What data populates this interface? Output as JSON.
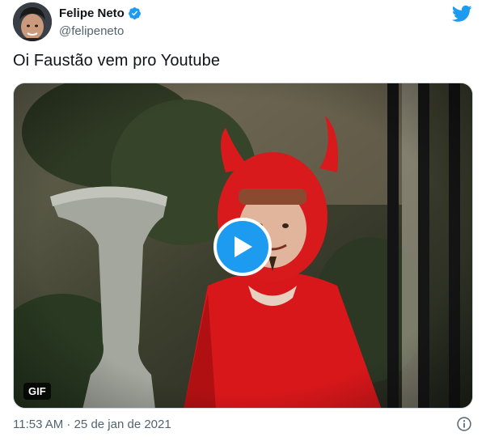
{
  "author": {
    "name": "Felipe Neto",
    "handle": "@felipeneto",
    "verified": true
  },
  "tweet": {
    "text": "Oi Faustão vem pro Youtube",
    "media_badge": "GIF",
    "timestamp": "11:53 AM · 25 de jan de 2021"
  },
  "icons": {
    "brand": "twitter-bird-icon",
    "verified": "verified-badge-icon",
    "play": "play-icon",
    "info": "info-icon"
  },
  "colors": {
    "brand_blue": "#1d9bf0",
    "text_primary": "#0f1419",
    "text_secondary": "#536471"
  }
}
